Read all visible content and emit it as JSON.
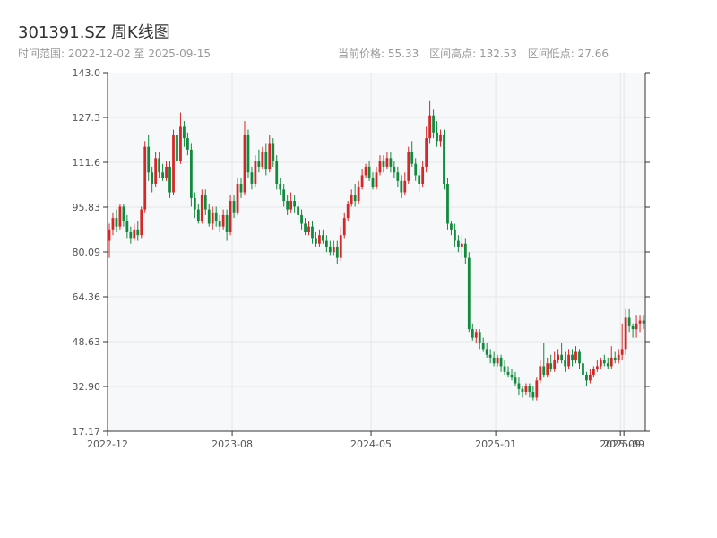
{
  "header": {
    "title": "301391.SZ 周K线图",
    "date_range": "时间范围: 2022-12-02 至 2025-09-15",
    "current_price": "当前价格: 55.33",
    "range_high": "区间高点: 132.53",
    "range_low": "区间低点: 27.66"
  },
  "colors": {
    "up": "#d62728",
    "down": "#108a3c",
    "grid": "#e6e6e6",
    "axis": "#333333",
    "plot_bg": "#f7f8fa"
  },
  "chart_data": {
    "type": "candlestick",
    "y_ticks": [
      "143.0",
      "127.3",
      "111.6",
      "95.83",
      "80.09",
      "64.36",
      "48.63",
      "32.90",
      "17.17"
    ],
    "ylim": [
      17.17,
      143.0
    ],
    "x_ticks": [
      {
        "label": "2022-12",
        "index": 0
      },
      {
        "label": "2023-08",
        "index": 35
      },
      {
        "label": "2024-05",
        "index": 74
      },
      {
        "label": "2025-01",
        "index": 109
      },
      {
        "label": "2025-09",
        "index": 144
      },
      {
        "label": "2025-09",
        "index": 145
      }
    ],
    "candles": [
      [
        84,
        88,
        78,
        90
      ],
      [
        88,
        92,
        86,
        94
      ],
      [
        92,
        89,
        87,
        95
      ],
      [
        89,
        96,
        88,
        97
      ],
      [
        96,
        91,
        89,
        97
      ],
      [
        91,
        87,
        85,
        93
      ],
      [
        87,
        85,
        83,
        89
      ],
      [
        85,
        88,
        84,
        90
      ],
      [
        88,
        86,
        84,
        91
      ],
      [
        86,
        95,
        85,
        96
      ],
      [
        95,
        117,
        94,
        119
      ],
      [
        117,
        108,
        105,
        121
      ],
      [
        108,
        104,
        101,
        110
      ],
      [
        104,
        113,
        103,
        115
      ],
      [
        113,
        108,
        106,
        115
      ],
      [
        108,
        106,
        105,
        111
      ],
      [
        106,
        110,
        105,
        112
      ],
      [
        110,
        101,
        99,
        112
      ],
      [
        101,
        121,
        100,
        123
      ],
      [
        121,
        112,
        110,
        127
      ],
      [
        112,
        124,
        111,
        129
      ],
      [
        124,
        120,
        117,
        126
      ],
      [
        120,
        116,
        114,
        122
      ],
      [
        116,
        99,
        96,
        118
      ],
      [
        99,
        95,
        92,
        101
      ],
      [
        95,
        91,
        90,
        97
      ],
      [
        91,
        100,
        90,
        102
      ],
      [
        100,
        95,
        93,
        102
      ],
      [
        95,
        90,
        89,
        97
      ],
      [
        90,
        94,
        88,
        96
      ],
      [
        94,
        91,
        89,
        96
      ],
      [
        91,
        89,
        87,
        93
      ],
      [
        89,
        93,
        88,
        95
      ],
      [
        93,
        87,
        84,
        95
      ],
      [
        87,
        98,
        86,
        100
      ],
      [
        98,
        94,
        92,
        100
      ],
      [
        94,
        104,
        93,
        106
      ],
      [
        104,
        101,
        99,
        106
      ],
      [
        101,
        121,
        100,
        126
      ],
      [
        121,
        108,
        106,
        123
      ],
      [
        108,
        104,
        102,
        110
      ],
      [
        104,
        112,
        103,
        114
      ],
      [
        112,
        110,
        108,
        116
      ],
      [
        110,
        115,
        109,
        117
      ],
      [
        115,
        109,
        107,
        118
      ],
      [
        109,
        118,
        108,
        121
      ],
      [
        118,
        112,
        110,
        120
      ],
      [
        112,
        104,
        102,
        114
      ],
      [
        104,
        102,
        100,
        106
      ],
      [
        102,
        98,
        96,
        104
      ],
      [
        98,
        95,
        93,
        100
      ],
      [
        95,
        98,
        94,
        101
      ],
      [
        98,
        96,
        94,
        100
      ],
      [
        96,
        93,
        91,
        98
      ],
      [
        93,
        90,
        88,
        95
      ],
      [
        90,
        87,
        86,
        92
      ],
      [
        87,
        89,
        86,
        91
      ],
      [
        89,
        85,
        83,
        91
      ],
      [
        85,
        83,
        82,
        87
      ],
      [
        83,
        86,
        82,
        88
      ],
      [
        86,
        84,
        83,
        88
      ],
      [
        84,
        82,
        80,
        86
      ],
      [
        82,
        80,
        79,
        84
      ],
      [
        80,
        82,
        79,
        84
      ],
      [
        82,
        78,
        76,
        84
      ],
      [
        78,
        86,
        77,
        89
      ],
      [
        86,
        92,
        85,
        94
      ],
      [
        92,
        97,
        91,
        98
      ],
      [
        97,
        100,
        96,
        102
      ],
      [
        100,
        98,
        96,
        104
      ],
      [
        98,
        103,
        97,
        105
      ],
      [
        103,
        107,
        102,
        109
      ],
      [
        107,
        110,
        106,
        111
      ],
      [
        110,
        106,
        105,
        112
      ],
      [
        106,
        103,
        102,
        108
      ],
      [
        103,
        108,
        102,
        110
      ],
      [
        108,
        112,
        107,
        114
      ],
      [
        112,
        110,
        108,
        114
      ],
      [
        110,
        113,
        109,
        115
      ],
      [
        113,
        110,
        108,
        115
      ],
      [
        110,
        108,
        106,
        112
      ],
      [
        108,
        105,
        103,
        110
      ],
      [
        105,
        101,
        99,
        107
      ],
      [
        101,
        105,
        100,
        108
      ],
      [
        105,
        115,
        104,
        117
      ],
      [
        115,
        111,
        110,
        119
      ],
      [
        111,
        107,
        105,
        113
      ],
      [
        107,
        104,
        101,
        109
      ],
      [
        104,
        110,
        103,
        112
      ],
      [
        110,
        120,
        108,
        124
      ],
      [
        120,
        128,
        118,
        133
      ],
      [
        128,
        122,
        120,
        130
      ],
      [
        122,
        119,
        117,
        126
      ],
      [
        119,
        121,
        117,
        123
      ],
      [
        121,
        104,
        102,
        123
      ],
      [
        104,
        90,
        88,
        106
      ],
      [
        90,
        88,
        86,
        91
      ],
      [
        88,
        84,
        82,
        90
      ],
      [
        84,
        82,
        80,
        86
      ],
      [
        82,
        83,
        78,
        86
      ],
      [
        83,
        78,
        76,
        85
      ],
      [
        78,
        53,
        52,
        80
      ],
      [
        53,
        50,
        49,
        55
      ],
      [
        50,
        52,
        48,
        53
      ],
      [
        52,
        48,
        46,
        53
      ],
      [
        48,
        46,
        45,
        50
      ],
      [
        46,
        44,
        43,
        48
      ],
      [
        44,
        43,
        41,
        46
      ],
      [
        43,
        41,
        40,
        45
      ],
      [
        41,
        43,
        40,
        44
      ],
      [
        43,
        40,
        38,
        44
      ],
      [
        40,
        38,
        37,
        42
      ],
      [
        38,
        37,
        36,
        40
      ],
      [
        37,
        36,
        35,
        39
      ],
      [
        36,
        34,
        33,
        38
      ],
      [
        34,
        32,
        30,
        36
      ],
      [
        32,
        31,
        29,
        33
      ],
      [
        31,
        33,
        30,
        34
      ],
      [
        33,
        31,
        29,
        34
      ],
      [
        31,
        29,
        28,
        33
      ],
      [
        29,
        35,
        28,
        36
      ],
      [
        35,
        40,
        34,
        42
      ],
      [
        40,
        37,
        36,
        48
      ],
      [
        37,
        41,
        36,
        43
      ],
      [
        41,
        39,
        38,
        44
      ],
      [
        39,
        42,
        38,
        45
      ],
      [
        42,
        44,
        41,
        46
      ],
      [
        44,
        42,
        41,
        48
      ],
      [
        42,
        40,
        38,
        45
      ],
      [
        40,
        44,
        39,
        46
      ],
      [
        44,
        42,
        40,
        46
      ],
      [
        42,
        45,
        41,
        47
      ],
      [
        45,
        41,
        39,
        46
      ],
      [
        41,
        37,
        35,
        42
      ],
      [
        37,
        35,
        33,
        38
      ],
      [
        35,
        37,
        34,
        39
      ],
      [
        37,
        39,
        36,
        40
      ],
      [
        39,
        40,
        38,
        42
      ],
      [
        40,
        42,
        39,
        43
      ],
      [
        42,
        41,
        40,
        44
      ],
      [
        41,
        40,
        39,
        43
      ],
      [
        40,
        43,
        39,
        47
      ],
      [
        43,
        42,
        41,
        45
      ],
      [
        42,
        44,
        41,
        46
      ],
      [
        44,
        46,
        42,
        55
      ],
      [
        46,
        57,
        44,
        60
      ],
      [
        57,
        54,
        52,
        60
      ],
      [
        54,
        53,
        50,
        55
      ],
      [
        53,
        55,
        50,
        58
      ],
      [
        55,
        56,
        52,
        58
      ],
      [
        56,
        55,
        53,
        58
      ]
    ]
  }
}
